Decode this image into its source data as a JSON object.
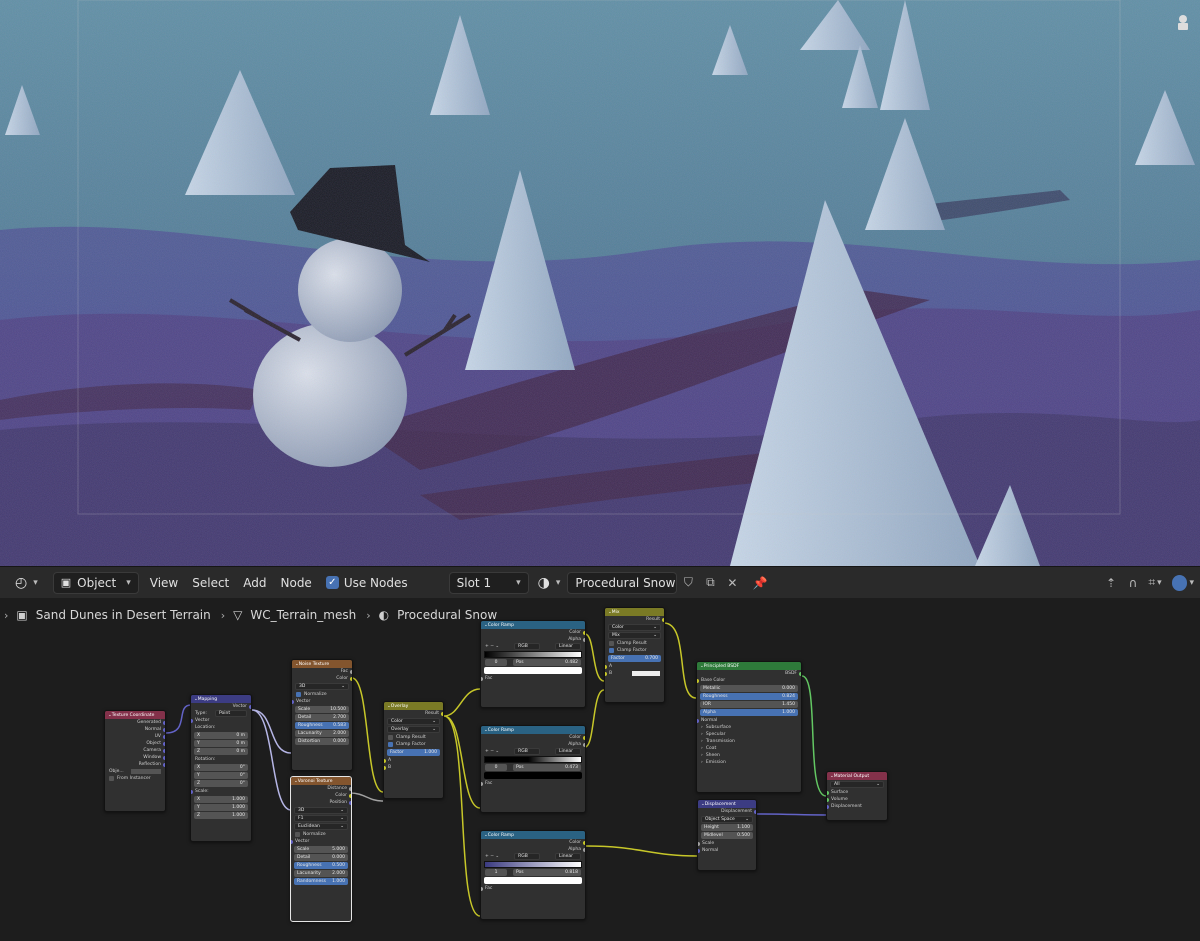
{
  "header": {
    "editor_type_icon": "node-editor-icon",
    "mode_label": "Object",
    "menus": [
      "View",
      "Select",
      "Add",
      "Node"
    ],
    "use_nodes_label": "Use Nodes",
    "slot_label": "Slot 1",
    "material_name": "Procedural Snow"
  },
  "breadcrumb": {
    "items": [
      "Sand Dunes in Desert Terrain",
      "WC_Terrain_mesh",
      "Procedural Snow"
    ]
  },
  "nodes": {
    "tex_coord": {
      "title": "Texture Coordinate",
      "outputs": [
        "Generated",
        "Normal",
        "UV",
        "Object",
        "Camera",
        "Window",
        "Reflection"
      ],
      "object_label": "Obje...",
      "from_instancer": "From Instancer"
    },
    "mapping": {
      "title": "Mapping",
      "out": "Vector",
      "type_label": "Type:",
      "type_value": "Point",
      "vector": "Vector",
      "location": "Location:",
      "loc": [
        [
          "X",
          "0 m"
        ],
        [
          "Y",
          "0 m"
        ],
        [
          "Z",
          "0 m"
        ]
      ],
      "rotation": "Rotation:",
      "rot": [
        [
          "X",
          "0°"
        ],
        [
          "Y",
          "0°"
        ],
        [
          "Z",
          "0°"
        ]
      ],
      "scale": "Scale:",
      "scl": [
        [
          "X",
          "1.000"
        ],
        [
          "Y",
          "1.000"
        ],
        [
          "Z",
          "1.000"
        ]
      ]
    },
    "noise": {
      "title": "Noise Texture",
      "outs": [
        "Fac",
        "Color"
      ],
      "dim": "3D",
      "normalize": "Normalize",
      "vector": "Vector",
      "fields": [
        [
          "Scale",
          "10.500"
        ],
        [
          "Detail",
          "2.700"
        ],
        [
          "Roughness",
          "0.583"
        ],
        [
          "Lacunarity",
          "2.000"
        ],
        [
          "Distortion",
          "0.000"
        ]
      ]
    },
    "voronoi": {
      "title": "Voronoi Texture",
      "outs": [
        "Distance",
        "Color",
        "Position"
      ],
      "dim": "3D",
      "feature": "F1",
      "metric": "Euclidean",
      "normalize": "Normalize",
      "vector": "Vector",
      "fields": [
        [
          "Scale",
          "5.000"
        ],
        [
          "Detail",
          "0.000"
        ],
        [
          "Roughness",
          "0.500"
        ],
        [
          "Lacunarity",
          "2.000"
        ],
        [
          "Randomness",
          "1.000"
        ]
      ]
    },
    "overlay": {
      "title": "Overlay",
      "result": "Result",
      "dtype": "Color",
      "mode": "Overlay",
      "clamp_result": "Clamp Result",
      "clamp_factor": "Clamp Factor",
      "factor": [
        "Factor",
        "1.000"
      ],
      "a": "A",
      "b": "B"
    },
    "ramp1": {
      "title": "Color Ramp",
      "outs": [
        "Color",
        "Alpha"
      ],
      "mode": "RGB",
      "interp": "Linear",
      "index": "0",
      "pos": [
        "Pos",
        "0.482"
      ],
      "fac": "Fac"
    },
    "ramp2": {
      "title": "Color Ramp",
      "outs": [
        "Color",
        "Alpha"
      ],
      "mode": "RGB",
      "interp": "Linear",
      "index": "0",
      "pos": [
        "Pos",
        "0.473"
      ],
      "fac": "Fac"
    },
    "ramp3": {
      "title": "Color Ramp",
      "outs": [
        "Color",
        "Alpha"
      ],
      "mode": "RGB",
      "interp": "Linear",
      "index": "1",
      "pos": [
        "Pos",
        "0.818"
      ],
      "fac": "Fac"
    },
    "mix": {
      "title": "Mix",
      "result": "Result",
      "dtype": "Color",
      "mode": "Mix",
      "clamp_result": "Clamp Result",
      "clamp_factor": "Clamp Factor",
      "factor": [
        "Factor",
        "0.700"
      ],
      "a": "A",
      "b": "B"
    },
    "bsdf": {
      "title": "Principled BSDF",
      "out": "BSDF",
      "base_color": "Base Color",
      "fields": [
        [
          "Metallic",
          "0.000"
        ],
        [
          "Roughness",
          "0.824"
        ],
        [
          "IOR",
          "1.450"
        ],
        [
          "Alpha",
          "1.000"
        ]
      ],
      "normal": "Normal",
      "panels": [
        "Subsurface",
        "Specular",
        "Transmission",
        "Coat",
        "Sheen",
        "Emission"
      ]
    },
    "disp": {
      "title": "Displacement",
      "out": "Displacement",
      "space": "Object Space",
      "fields": [
        [
          "Height",
          "1.100"
        ],
        [
          "Midlevel",
          "0.500"
        ]
      ],
      "scale": "Scale",
      "normal": "Normal"
    },
    "output": {
      "title": "Material Output",
      "target": "All",
      "inputs": [
        "Surface",
        "Volume",
        "Displacement"
      ]
    }
  }
}
